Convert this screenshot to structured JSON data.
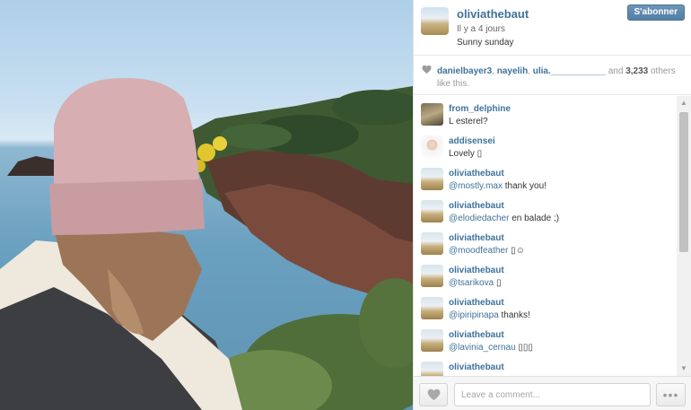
{
  "post": {
    "username": "oliviathebaut",
    "time": "Il y a 4 jours",
    "caption": "Sunny sunday",
    "follow_label": "S'abonner"
  },
  "likes": {
    "users": [
      "danielbayer3",
      "nayelih",
      "ulia.___________"
    ],
    "sep": ", ",
    "and_text": " and ",
    "count": "3,233",
    "suffix": " others like this."
  },
  "comments": [
    {
      "user": "from_delphine",
      "text": "L esterel?",
      "mention": "",
      "avatar": "delphine"
    },
    {
      "user": "addisensei",
      "text": "Lovely ▯",
      "mention": "",
      "avatar": "addi"
    },
    {
      "user": "oliviathebaut",
      "mention": "@mostly.max",
      "text": " thank you!",
      "avatar": "olivia"
    },
    {
      "user": "oliviathebaut",
      "mention": "@elodiedacher",
      "text": " en balade ;)",
      "avatar": "olivia"
    },
    {
      "user": "oliviathebaut",
      "mention": "@moodfeather",
      "text": " ▯☺",
      "avatar": "olivia"
    },
    {
      "user": "oliviathebaut",
      "mention": "@tsarikova",
      "text": " ▯",
      "avatar": "olivia"
    },
    {
      "user": "oliviathebaut",
      "mention": "@ipiripinapa",
      "text": " thanks!",
      "avatar": "olivia"
    },
    {
      "user": "oliviathebaut",
      "mention": "@lavinia_cernau",
      "text": " ▯▯▯",
      "avatar": "olivia"
    },
    {
      "user": "oliviathebaut",
      "mention": "",
      "text": "",
      "avatar": "olivia"
    }
  ],
  "footer": {
    "comment_placeholder": "Leave a comment...",
    "more_label": "•••"
  },
  "icons": {
    "likes": "heart-icon",
    "like_button": "heart-icon",
    "more": "ellipsis-icon",
    "scroll_up": "triangle-up-icon",
    "scroll_down": "triangle-down-icon"
  },
  "colors": {
    "link": "#3f729b",
    "follow_button": "#517fa4"
  }
}
